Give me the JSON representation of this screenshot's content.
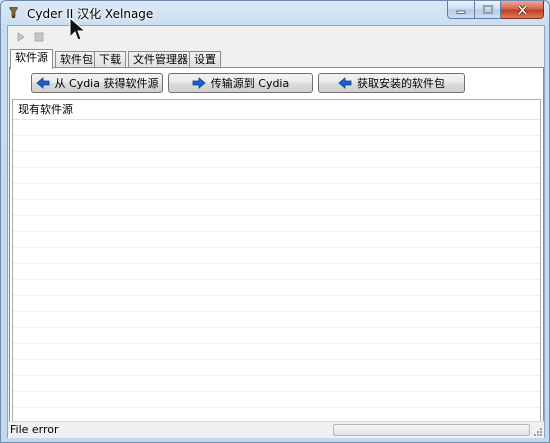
{
  "window": {
    "title": "Cyder II 汉化 Xelnage",
    "icons": {
      "app": "app-icon",
      "minimize": "minimize-icon",
      "maximize": "maximize-icon",
      "close": "close-icon"
    }
  },
  "toolbar": {
    "items": [
      {
        "name": "play-button",
        "icon": "play-icon"
      },
      {
        "name": "stop-button",
        "icon": "stop-icon"
      }
    ]
  },
  "tabs": [
    {
      "label": "软件源",
      "active": true
    },
    {
      "label": "软件包",
      "active": false
    },
    {
      "label": "下载",
      "active": false
    },
    {
      "label": "文件管理器",
      "active": false
    },
    {
      "label": "设置",
      "active": false
    }
  ],
  "actions": {
    "get_sources": "从 Cydia 获得软件源",
    "send_sources": "传输源到 Cydia",
    "get_installed": "获取安装的软件包"
  },
  "list": {
    "header": "现有软件源",
    "rows": []
  },
  "status": {
    "text": "File error",
    "progress": 0
  },
  "colors": {
    "arrow_blue": "#1e5fd0",
    "close_red": "#c2391b"
  }
}
